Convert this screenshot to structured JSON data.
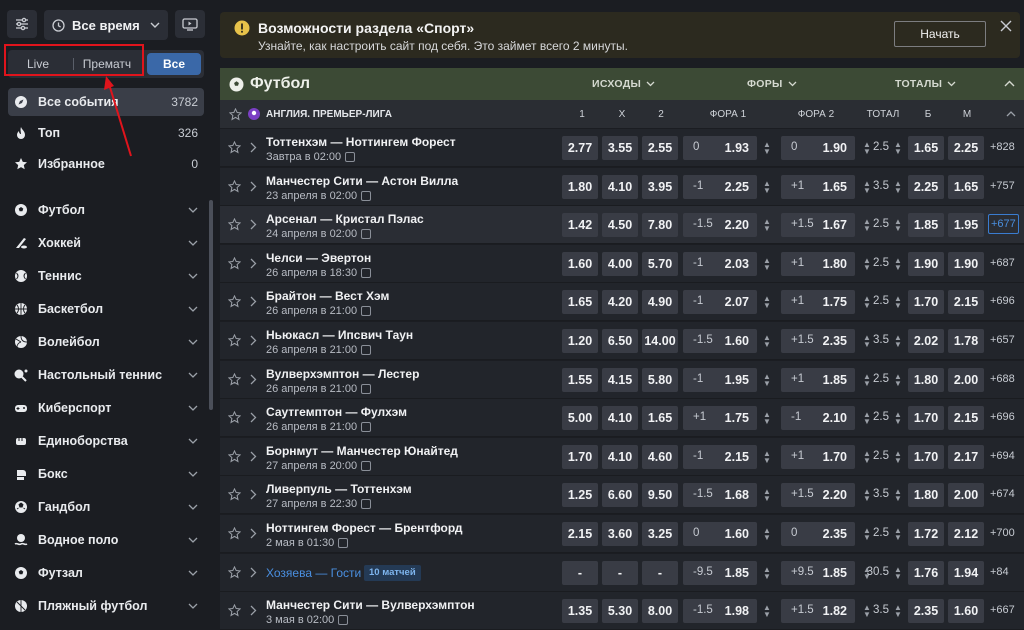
{
  "topbar": {
    "time_filter": "Все время"
  },
  "mode_tabs": [
    {
      "label": "Live",
      "active": false
    },
    {
      "label": "Прематч",
      "active": false
    },
    {
      "label": "Все",
      "active": true
    }
  ],
  "quick": [
    {
      "label": "Все события",
      "count": "3782",
      "icon": "compass-icon",
      "active": true
    },
    {
      "label": "Топ",
      "count": "326",
      "icon": "flame-icon",
      "active": false
    },
    {
      "label": "Избранное",
      "count": "0",
      "icon": "star-icon",
      "active": false
    }
  ],
  "sports": [
    {
      "label": "Футбол",
      "icon": "soccer-ball-icon"
    },
    {
      "label": "Хоккей",
      "icon": "hockey-icon"
    },
    {
      "label": "Теннис",
      "icon": "tennis-icon"
    },
    {
      "label": "Баскетбол",
      "icon": "basketball-icon"
    },
    {
      "label": "Волейбол",
      "icon": "volleyball-icon"
    },
    {
      "label": "Настольный теннис",
      "icon": "table-tennis-icon"
    },
    {
      "label": "Киберспорт",
      "icon": "gamepad-icon"
    },
    {
      "label": "Единоборства",
      "icon": "fist-icon"
    },
    {
      "label": "Бокс",
      "icon": "boxing-glove-icon"
    },
    {
      "label": "Гандбол",
      "icon": "handball-icon"
    },
    {
      "label": "Водное поло",
      "icon": "water-polo-icon"
    },
    {
      "label": "Футзал",
      "icon": "futsal-icon"
    },
    {
      "label": "Пляжный футбол",
      "icon": "beach-soccer-icon"
    }
  ],
  "notice": {
    "title": "Возможности раздела «Спорт»",
    "text": "Узнайте, как настроить сайт под себя. Это займет всего 2 минуты.",
    "button": "Начать"
  },
  "sport_header": {
    "title": "Футбол",
    "filters": [
      "ИСХОДЫ",
      "ФОРЫ",
      "ТОТАЛЫ"
    ]
  },
  "league": {
    "name": "АНГЛИЯ. ПРЕМЬЕР-ЛИГА",
    "columns": [
      "1",
      "X",
      "2",
      "ФОРА 1",
      "ФОРА 2",
      "ТОТАЛ",
      "Б",
      "М"
    ]
  },
  "matches": [
    {
      "teams": "Тоттенхэм — Ноттингем Форест",
      "date": "Завтра в 02:00",
      "o1": "2.77",
      "ox": "3.55",
      "o2": "2.55",
      "h1": "0",
      "h1o": "1.93",
      "h2": "0",
      "h2o": "1.90",
      "total": "2.5",
      "over": "1.65",
      "under": "2.25",
      "more": "+828"
    },
    {
      "teams": "Манчестер Сити — Астон Вилла",
      "date": "23 апреля в 02:00",
      "o1": "1.80",
      "ox": "4.10",
      "o2": "3.95",
      "h1": "-1",
      "h1o": "2.25",
      "h2": "+1",
      "h2o": "1.65",
      "total": "3.5",
      "over": "2.25",
      "under": "1.65",
      "more": "+757"
    },
    {
      "teams": "Арсенал — Кристал Пэлас",
      "date": "24 апреля в 02:00",
      "o1": "1.42",
      "ox": "4.50",
      "o2": "7.80",
      "h1": "-1.5",
      "h1o": "2.20",
      "h2": "+1.5",
      "h2o": "1.67",
      "total": "2.5",
      "over": "1.85",
      "under": "1.95",
      "more": "+677"
    },
    {
      "teams": "Челси — Эвертон",
      "date": "26 апреля в 18:30",
      "o1": "1.60",
      "ox": "4.00",
      "o2": "5.70",
      "h1": "-1",
      "h1o": "2.03",
      "h2": "+1",
      "h2o": "1.80",
      "total": "2.5",
      "over": "1.90",
      "under": "1.90",
      "more": "+687"
    },
    {
      "teams": "Брайтон — Вест Хэм",
      "date": "26 апреля в 21:00",
      "o1": "1.65",
      "ox": "4.20",
      "o2": "4.90",
      "h1": "-1",
      "h1o": "2.07",
      "h2": "+1",
      "h2o": "1.75",
      "total": "2.5",
      "over": "1.70",
      "under": "2.15",
      "more": "+696"
    },
    {
      "teams": "Ньюкасл — Ипсвич Таун",
      "date": "26 апреля в 21:00",
      "o1": "1.20",
      "ox": "6.50",
      "o2": "14.00",
      "h1": "-1.5",
      "h1o": "1.60",
      "h2": "+1.5",
      "h2o": "2.35",
      "total": "3.5",
      "over": "2.02",
      "under": "1.78",
      "more": "+657"
    },
    {
      "teams": "Вулверхэмптон — Лестер",
      "date": "26 апреля в 21:00",
      "o1": "1.55",
      "ox": "4.15",
      "o2": "5.80",
      "h1": "-1",
      "h1o": "1.95",
      "h2": "+1",
      "h2o": "1.85",
      "total": "2.5",
      "over": "1.80",
      "under": "2.00",
      "more": "+688"
    },
    {
      "teams": "Саутгемптон — Фулхэм",
      "date": "26 апреля в 21:00",
      "o1": "5.00",
      "ox": "4.10",
      "o2": "1.65",
      "h1": "+1",
      "h1o": "1.75",
      "h2": "-1",
      "h2o": "2.10",
      "total": "2.5",
      "over": "1.70",
      "under": "2.15",
      "more": "+696"
    },
    {
      "teams": "Борнмут — Манчестер Юнайтед",
      "date": "27 апреля в 20:00",
      "o1": "1.70",
      "ox": "4.10",
      "o2": "4.60",
      "h1": "-1",
      "h1o": "2.15",
      "h2": "+1",
      "h2o": "1.70",
      "total": "2.5",
      "over": "1.70",
      "under": "2.17",
      "more": "+694"
    },
    {
      "teams": "Ливерпуль — Тоттенхэм",
      "date": "27 апреля в 22:30",
      "o1": "1.25",
      "ox": "6.60",
      "o2": "9.50",
      "h1": "-1.5",
      "h1o": "1.68",
      "h2": "+1.5",
      "h2o": "2.20",
      "total": "3.5",
      "over": "1.80",
      "under": "2.00",
      "more": "+674"
    },
    {
      "teams": "Ноттингем Форест — Брентфорд",
      "date": "2 мая в 01:30",
      "o1": "2.15",
      "ox": "3.60",
      "o2": "3.25",
      "h1": "0",
      "h1o": "1.60",
      "h2": "0",
      "h2o": "2.35",
      "total": "2.5",
      "over": "1.72",
      "under": "2.12",
      "more": "+700"
    },
    {
      "teams": "Хозяева — Гости",
      "badge": "10 матчей",
      "o1": "-",
      "ox": "-",
      "o2": "-",
      "h1": "-9.5",
      "h1o": "1.85",
      "h2": "+9.5",
      "h2o": "1.85",
      "total": "30.5",
      "over": "1.76",
      "under": "1.94",
      "more": "+84"
    },
    {
      "teams": "Манчестер Сити — Вулверхэмптон",
      "date": "3 мая в 02:00",
      "o1": "1.35",
      "ox": "5.30",
      "o2": "8.00",
      "h1": "-1.5",
      "h1o": "1.98",
      "h2": "+1.5",
      "h2o": "1.82",
      "total": "3.5",
      "over": "2.35",
      "under": "1.60",
      "more": "+667"
    }
  ]
}
